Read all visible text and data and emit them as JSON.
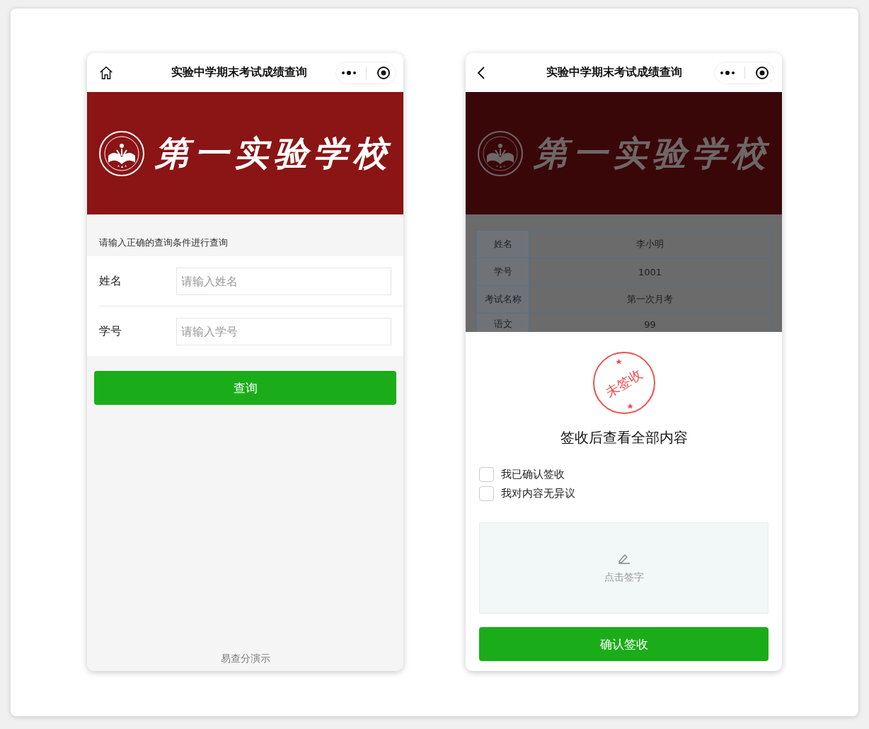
{
  "left_phone": {
    "nav": {
      "title": "实验中学期末考试成绩查询",
      "kind": "home"
    },
    "banner": {
      "school": "第一实验学校",
      "dimmed": false
    },
    "hint": "请输入正确的查询条件进行查询",
    "fields": [
      {
        "label": "姓名",
        "placeholder": "请输入姓名"
      },
      {
        "label": "学号",
        "placeholder": "请输入学号"
      }
    ],
    "submit": "查询",
    "footer": "易查分演示"
  },
  "right_phone": {
    "nav": {
      "title": "实验中学期末考试成绩查询",
      "kind": "back"
    },
    "banner": {
      "school": "第一实验学校",
      "dimmed": true
    },
    "result_rows": [
      {
        "label": "姓名",
        "value": "李小明"
      },
      {
        "label": "学号",
        "value": "1001"
      },
      {
        "label": "考试名称",
        "value": "第一次月考"
      },
      {
        "label": "语文",
        "value": "99"
      }
    ],
    "sheet": {
      "stamp": "未签收",
      "heading": "签收后查看全部内容",
      "checks": [
        {
          "label": "我已确认签收",
          "checked": false
        },
        {
          "label": "我对内容无异议",
          "checked": false
        }
      ],
      "signature": {
        "prompt": "点击签字"
      },
      "confirm": "确认签收"
    }
  }
}
